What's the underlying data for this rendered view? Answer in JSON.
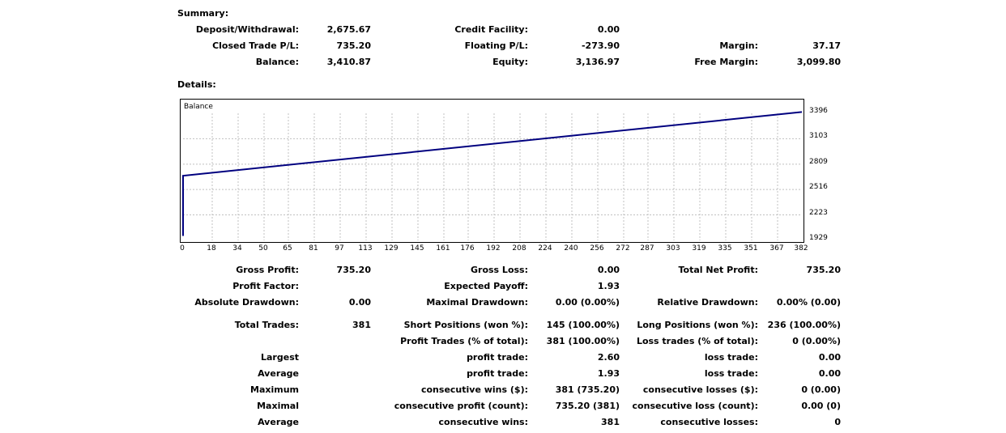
{
  "summary": {
    "heading": "Summary:",
    "rows": [
      [
        {
          "label": "Deposit/Withdrawal:",
          "value": "2,675.67"
        },
        {
          "label": "Credit Facility:",
          "value": "0.00"
        },
        {
          "label": "",
          "value": ""
        }
      ],
      [
        {
          "label": "Closed Trade P/L:",
          "value": "735.20"
        },
        {
          "label": "Floating P/L:",
          "value": "-273.90"
        },
        {
          "label": "Margin:",
          "value": "37.17"
        }
      ],
      [
        {
          "label": "Balance:",
          "value": "3,410.87"
        },
        {
          "label": "Equity:",
          "value": "3,136.97"
        },
        {
          "label": "Free Margin:",
          "value": "3,099.80"
        }
      ]
    ]
  },
  "details": {
    "heading": "Details:",
    "rows": [
      [
        {
          "label": "Gross Profit:",
          "value": "735.20"
        },
        {
          "label": "Gross Loss:",
          "value": "0.00"
        },
        {
          "label": "Total Net Profit:",
          "value": "735.20"
        }
      ],
      [
        {
          "label": "Profit Factor:",
          "value": ""
        },
        {
          "label": "Expected Payoff:",
          "value": "1.93"
        },
        {
          "label": "",
          "value": ""
        }
      ],
      [
        {
          "label": "Absolute Drawdown:",
          "value": "0.00"
        },
        {
          "label": "Maximal Drawdown:",
          "value": "0.00 (0.00%)"
        },
        {
          "label": "Relative Drawdown:",
          "value": "0.00% (0.00)"
        }
      ],
      [
        {
          "label": "Total Trades:",
          "value": "381"
        },
        {
          "label": "Short Positions (won %):",
          "value": "145 (100.00%)"
        },
        {
          "label": "Long Positions (won %):",
          "value": "236 (100.00%)"
        }
      ],
      [
        {
          "label": "",
          "value": ""
        },
        {
          "label": "Profit Trades (% of total):",
          "value": "381 (100.00%)"
        },
        {
          "label": "Loss trades (% of total):",
          "value": "0 (0.00%)"
        }
      ],
      [
        {
          "label": "Largest",
          "value": ""
        },
        {
          "label": "profit trade:",
          "value": "2.60"
        },
        {
          "label": "loss trade:",
          "value": "0.00"
        }
      ],
      [
        {
          "label": "Average",
          "value": ""
        },
        {
          "label": "profit trade:",
          "value": "1.93"
        },
        {
          "label": "loss trade:",
          "value": "0.00"
        }
      ],
      [
        {
          "label": "Maximum",
          "value": ""
        },
        {
          "label": "consecutive wins ($):",
          "value": "381 (735.20)"
        },
        {
          "label": "consecutive losses ($):",
          "value": "0 (0.00)"
        }
      ],
      [
        {
          "label": "Maximal",
          "value": ""
        },
        {
          "label": "consecutive profit (count):",
          "value": "735.20 (381)"
        },
        {
          "label": "consecutive loss (count):",
          "value": "0.00 (0)"
        }
      ],
      [
        {
          "label": "Average",
          "value": ""
        },
        {
          "label": "consecutive wins:",
          "value": "381"
        },
        {
          "label": "consecutive losses:",
          "value": "0"
        }
      ]
    ]
  },
  "chart_data": {
    "type": "line",
    "title": "Balance",
    "series": [
      {
        "name": "Balance",
        "x": [
          0,
          0,
          382
        ],
        "y": [
          1980,
          2676,
          3411
        ]
      }
    ],
    "x_ticks": [
      "0",
      "18",
      "34",
      "50",
      "65",
      "81",
      "97",
      "113",
      "129",
      "145",
      "161",
      "176",
      "192",
      "208",
      "224",
      "240",
      "256",
      "272",
      "287",
      "303",
      "319",
      "335",
      "351",
      "367",
      "382"
    ],
    "y_ticks": [
      "3396",
      "3103",
      "2809",
      "2516",
      "2223",
      "1929"
    ],
    "xlim": [
      0,
      382
    ],
    "ylim": [
      1929,
      3396
    ],
    "grid": true,
    "colors": {
      "line": "#00007f",
      "grid": "#c0c0c0",
      "border": "#000000"
    }
  }
}
